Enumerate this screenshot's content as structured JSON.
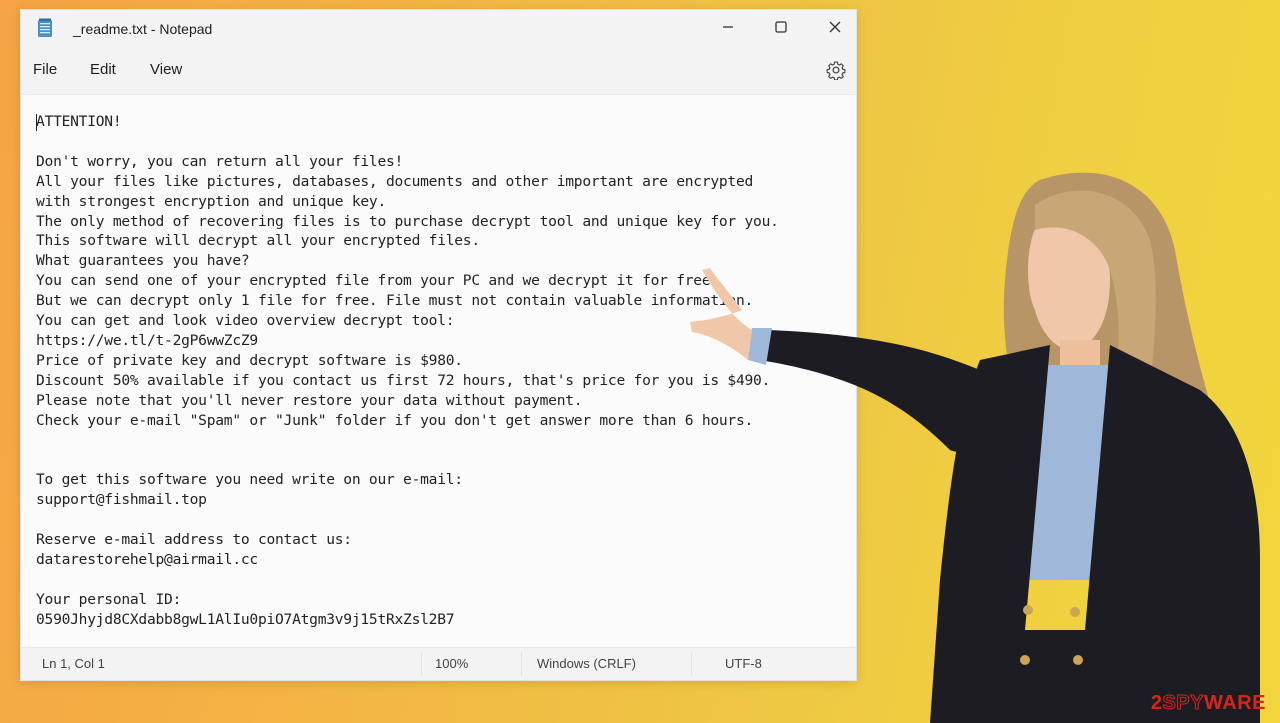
{
  "window": {
    "title": "_readme.txt - Notepad",
    "app_icon": "notepad-icon",
    "controls": {
      "minimize": "minimize-icon",
      "maximize": "maximize-icon",
      "close": "close-icon"
    }
  },
  "menu": {
    "items": [
      {
        "label": "File"
      },
      {
        "label": "Edit"
      },
      {
        "label": "View"
      }
    ],
    "settings_icon": "gear-icon"
  },
  "document": {
    "content": "ATTENTION!\n\nDon't worry, you can return all your files!\nAll your files like pictures, databases, documents and other important are encrypted\nwith strongest encryption and unique key.\nThe only method of recovering files is to purchase decrypt tool and unique key for you.\nThis software will decrypt all your encrypted files.\nWhat guarantees you have?\nYou can send one of your encrypted file from your PC and we decrypt it for free.\nBut we can decrypt only 1 file for free. File must not contain valuable information.\nYou can get and look video overview decrypt tool:\nhttps://we.tl/t-2gP6wwZcZ9\nPrice of private key and decrypt software is $980.\nDiscount 50% available if you contact us first 72 hours, that's price for you is $490.\nPlease note that you'll never restore your data without payment.\nCheck your e-mail \"Spam\" or \"Junk\" folder if you don't get answer more than 6 hours.\n\n\nTo get this software you need write on our e-mail:\nsupport@fishmail.top\n\nReserve e-mail address to contact us:\ndatarestorehelp@airmail.cc\n\nYour personal ID:\n0590Jhyjd8CXdabb8gwL1AlIu0piO7Atgm3v9j15tRxZsl2B7"
  },
  "statusbar": {
    "position": "Ln 1, Col 1",
    "zoom": "100%",
    "line_ending": "Windows (CRLF)",
    "encoding": "UTF-8"
  },
  "watermark": {
    "prefix": "2",
    "spy": "SPY",
    "ware": "WARE"
  },
  "colors": {
    "background_left": "#f6a445",
    "background_right": "#f2d53c",
    "logo_red": "#d8251c"
  }
}
